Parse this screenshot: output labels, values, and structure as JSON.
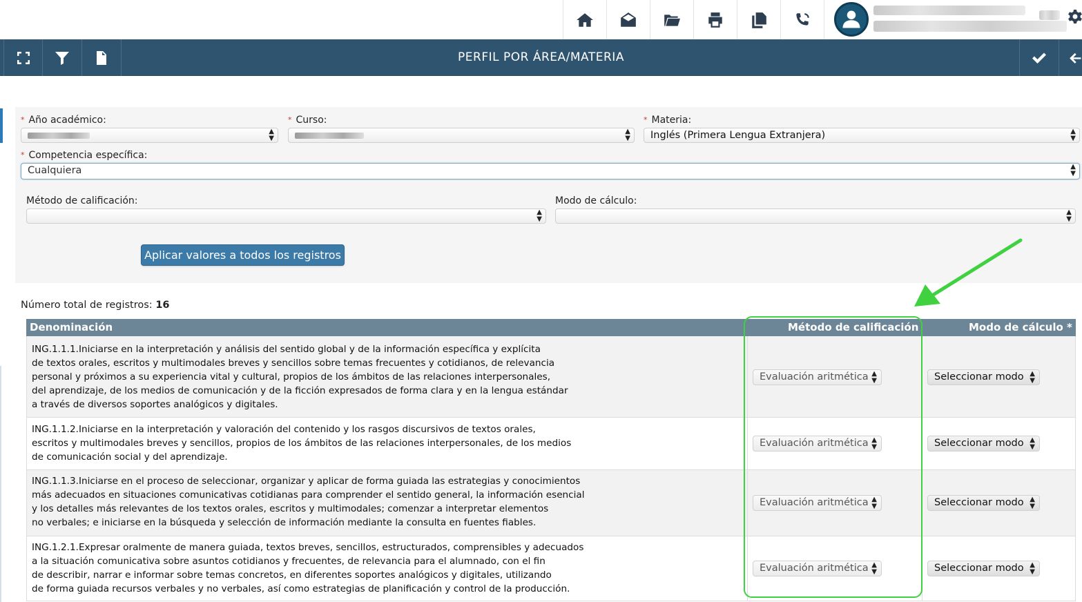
{
  "topbar": {
    "icons": [
      "home-icon",
      "mail-icon",
      "folder-icon",
      "print-icon",
      "copy-icon",
      "phone-icon",
      "settings-icon"
    ]
  },
  "titlebar": {
    "title": "PERFIL POR ÁREA/MATERIA",
    "left_buttons": [
      "fullscreen-icon",
      "filter-icon",
      "pdf-icon"
    ],
    "right_buttons": [
      "check-icon",
      "back-arrow-icon"
    ]
  },
  "form": {
    "year_label": "Año académico:",
    "course_label": "Curso:",
    "subject_label": "Materia:",
    "subject_value": "Inglés (Primera Lengua Extranjera)",
    "competence_label": "Competencia específica:",
    "competence_value": "Cualquiera",
    "method_label": "Método de calificación:",
    "mode_label": "Modo de cálculo:",
    "apply_button": "Aplicar valores a todos los registros",
    "required_mark": "*"
  },
  "records": {
    "count_label": "Número total de registros:",
    "count_value": "16"
  },
  "table": {
    "headers": {
      "name": "Denominación",
      "method": "Método de calificación",
      "mode": "Modo de cálculo *"
    },
    "rows": [
      {
        "text": "ING.1.1.1.Iniciarse en la interpretación y análisis del sentido global y de la información específica y explícita\nde textos orales, escritos y multimodales breves y sencillos sobre temas frecuentes y cotidianos, de relevancia\npersonal y próximos a su experiencia vital y cultural, propios de los ámbitos de las relaciones interpersonales,\ndel aprendizaje, de los medios de comunicación y de la ficción expresados de forma clara y en la lengua estándar\na través de diversos soportes analógicos y digitales.",
        "method": "Evaluación aritmética",
        "mode": "Seleccionar modo"
      },
      {
        "text": "ING.1.1.2.Iniciarse en la interpretación y valoración del contenido y los rasgos discursivos de textos orales,\nescritos y multimodales breves y sencillos, propios de los ámbitos de las relaciones interpersonales, de los medios\nde comunicación social y del aprendizaje.",
        "method": "Evaluación aritmética",
        "mode": "Seleccionar modo"
      },
      {
        "text": "ING.1.1.3.Iniciarse en el proceso de seleccionar, organizar y aplicar de forma guiada las estrategias y conocimientos\nmás adecuados en situaciones comunicativas cotidianas para comprender el sentido general, la información esencial\ny los detalles más relevantes de los textos orales, escritos y multimodales; comenzar a interpretar elementos\nno verbales; e iniciarse en la búsqueda y selección de información mediante la consulta en fuentes fiables.",
        "method": "Evaluación aritmética",
        "mode": "Seleccionar modo"
      },
      {
        "text": "ING.1.2.1.Expresar oralmente de manera guiada, textos breves, sencillos, estructurados, comprensibles y adecuados\na la situación comunicativa sobre asuntos cotidianos y frecuentes, de relevancia para el alumnado, con el fin\nde describir, narrar e informar sobre temas concretos, en diferentes soportes analógicos y digitales, utilizando\nde forma guiada recursos verbales y no verbales, así como estrategias de planificación y control de la producción.",
        "method": "Evaluación aritmética",
        "mode": "Seleccionar modo"
      }
    ]
  },
  "colors": {
    "titlebar": "#2f5470",
    "table_header": "#6c8597",
    "button": "#3c7aa7",
    "highlight": "#3fd13f"
  }
}
